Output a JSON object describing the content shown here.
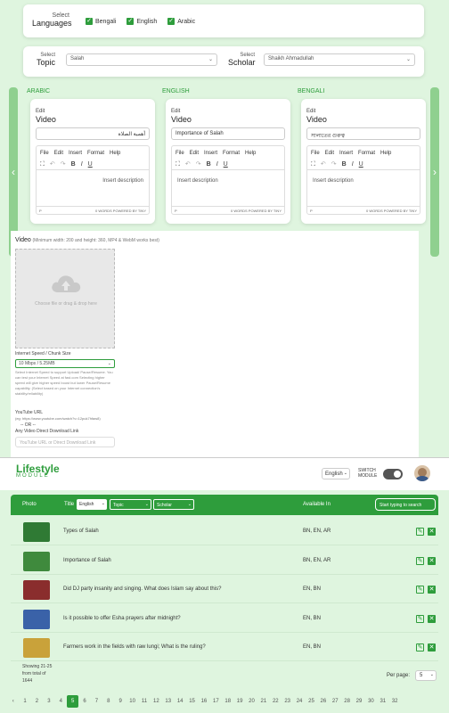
{
  "languages": {
    "label_top": "Select",
    "label_bottom": "Languages",
    "options": [
      "Bengali",
      "English",
      "Arabic"
    ]
  },
  "topic_select": {
    "label_top": "Select",
    "label_bottom": "Topic",
    "value": "Salah"
  },
  "scholar_select": {
    "label_top": "Select",
    "label_bottom": "Scholar",
    "value": "Shaikh Ahmadullah"
  },
  "columns": [
    {
      "lang": "ARABIC",
      "edit": "Edit",
      "heading": "Video",
      "title": "أهمية الصلاة",
      "placeholder": "Insert description",
      "status_left": "P",
      "status_right": "0 WORDS  POWERED BY TINY"
    },
    {
      "lang": "ENGLISH",
      "edit": "Edit",
      "heading": "Video",
      "title": "Importance of Salah",
      "placeholder": "Insert description",
      "status_left": "P",
      "status_right": "0 WORDS  POWERED BY TINY"
    },
    {
      "lang": "BENGALI",
      "edit": "Edit",
      "heading": "Video",
      "title": "সালাতের গুরুত্ব",
      "placeholder": "Insert description",
      "status_left": "P",
      "status_right": "0 WORDS  POWERED BY TINY"
    }
  ],
  "editor_menu": [
    "File",
    "Edit",
    "Insert",
    "Format",
    "Help"
  ],
  "upload": {
    "title": "Video",
    "hint": "(Minimum width: 200 and height: 360, MP4 & WebM works best)",
    "dropzone": "Choose file or drag & drop here",
    "speed_label": "Internet Speed / Chunk Size",
    "speed_value": "10 Mbps / 5.25MB",
    "speed_help": "Select Internet Speed to support Upload/ Pause/Resume. You can test your Internet Speed at fast.com Selecting higher speed will give higher speed boost but lower Pause/Resume capability. (Select based on your Internet connection's stability/reliability)",
    "youtube_label": "YouTube URL",
    "youtube_example": "(eg: https://www.youtube.com/watch?v=12puk7hfaw8)",
    "or": "-- OR --",
    "direct_label": "Any Video Direct Download Link",
    "direct_placeholder": "YouTube URL or Direct Download Link"
  },
  "header": {
    "logo_top": "Lifestyle",
    "logo_bottom": "MODULE",
    "lang": "English",
    "switch_top": "SWITCH",
    "switch_bottom": "MODULE"
  },
  "table": {
    "col_photo": "Photo",
    "col_title": "Title",
    "filter_lang": "English",
    "filter_topic": "Topic",
    "filter_scholar": "Scholar",
    "col_available": "Available In",
    "search_placeholder": "Start typing to search",
    "rows": [
      {
        "title": "Types of Salah",
        "available": "BN, EN, AR"
      },
      {
        "title": "Importance of Salah",
        "available": "BN, EN, AR"
      },
      {
        "title": "Did DJ party insanity and singing. What does Islam say about this?",
        "available": "EN, BN"
      },
      {
        "title": "Is it possible to offer Esha prayers after midnight?",
        "available": "EN, BN"
      },
      {
        "title": "Farmers work in the fields with raw lungi; What is the ruling?",
        "available": "EN, BN"
      }
    ],
    "showing_1": "Showing 21-25",
    "showing_2": "from total of",
    "showing_3": "1644",
    "per_page_label": "Per page:",
    "per_page_value": "5"
  },
  "pagination": {
    "prev": "‹",
    "pages": [
      "1",
      "2",
      "3",
      "4",
      "5",
      "6",
      "7",
      "8",
      "9",
      "10",
      "11",
      "12",
      "13",
      "14",
      "15",
      "16",
      "17",
      "18",
      "19",
      "20",
      "21",
      "22",
      "23",
      "24",
      "25",
      "26",
      "27",
      "28",
      "29",
      "30",
      "31",
      "32"
    ],
    "active": "5"
  },
  "colors": {
    "accent": "#2e9d3c",
    "bg": "#dff5df"
  }
}
